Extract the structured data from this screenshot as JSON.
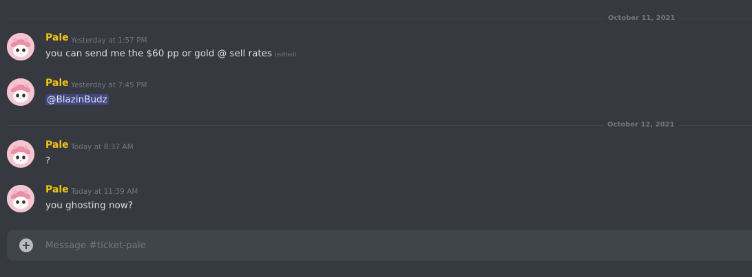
{
  "date_dividers": [
    {
      "label": "October 11, 2021"
    },
    {
      "label": "October 12, 2021"
    }
  ],
  "messages": [
    {
      "author": "Pale",
      "timestamp": "Yesterday at 1:57 PM",
      "text": "you can send me the $60 pp or gold @ sell rates",
      "edited_label": "(edited)"
    },
    {
      "author": "Pale",
      "timestamp": "Yesterday at 7:45 PM",
      "mention": "@BlazinBudz"
    },
    {
      "author": "Pale",
      "timestamp": "Today at 8:37 AM",
      "text": "?"
    },
    {
      "author": "Pale",
      "timestamp": "Today at 11:39 AM",
      "text": "you ghosting now?"
    }
  ],
  "composer": {
    "placeholder": "Message #ticket-pale",
    "value": ""
  },
  "colors": {
    "background": "#36393f",
    "author_name": "#f1c40f",
    "mention_bg": "#4a4f8a",
    "composer_bg": "#40444b"
  },
  "icons": {
    "avatar": "cat-in-pink-hat-avatar",
    "composer_attach": "plus-circle-icon"
  }
}
